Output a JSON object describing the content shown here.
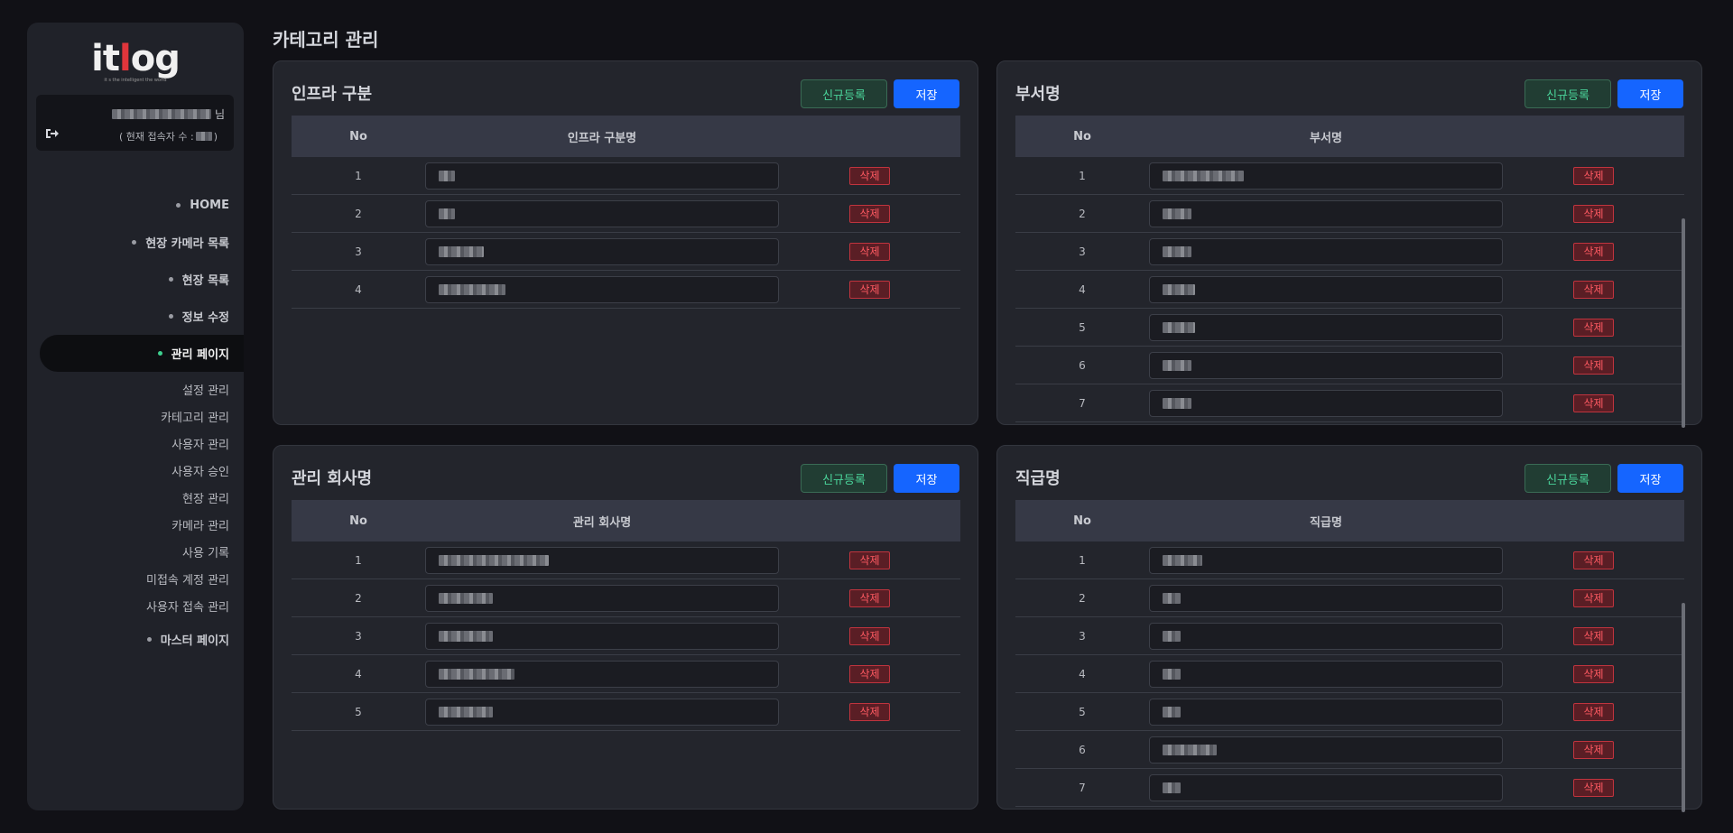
{
  "app": {
    "logo_main": "itlog",
    "logo_sub": "it s the intelligent the world"
  },
  "user": {
    "suffix": "님",
    "conn_prefix": "( 현재 접속자 수 :",
    "conn_suffix": ")"
  },
  "nav": {
    "items": [
      {
        "label": "HOME"
      },
      {
        "label": "현장 카메라 목록"
      },
      {
        "label": "현장 목록"
      },
      {
        "label": "정보 수정"
      },
      {
        "label": "관리 페이지"
      }
    ],
    "sub_items": [
      {
        "label": "설정 관리"
      },
      {
        "label": "카테고리 관리"
      },
      {
        "label": "사용자 관리"
      },
      {
        "label": "사용자 승인"
      },
      {
        "label": "현장 관리"
      },
      {
        "label": "카메라 관리"
      },
      {
        "label": "사용 기록"
      },
      {
        "label": "미접속 계정 관리"
      },
      {
        "label": "사용자 접속 관리"
      }
    ],
    "master": "마스터 페이지"
  },
  "page_title": "카테고리 관리",
  "buttons": {
    "new_label": "신규등록",
    "save_label": "저장",
    "delete_label": "삭제"
  },
  "panels": {
    "infra": {
      "title": "인프라 구분",
      "col_no": "No",
      "col_name": "인프라 구분명",
      "rows": [
        {
          "no": "1"
        },
        {
          "no": "2"
        },
        {
          "no": "3"
        },
        {
          "no": "4"
        }
      ]
    },
    "dept": {
      "title": "부서명",
      "col_no": "No",
      "col_name": "부서명",
      "rows": [
        {
          "no": "1"
        },
        {
          "no": "2"
        },
        {
          "no": "3"
        },
        {
          "no": "4"
        },
        {
          "no": "5"
        },
        {
          "no": "6"
        },
        {
          "no": "7"
        }
      ]
    },
    "company": {
      "title": "관리 회사명",
      "col_no": "No",
      "col_name": "관리 회사명",
      "rows": [
        {
          "no": "1"
        },
        {
          "no": "2"
        },
        {
          "no": "3"
        },
        {
          "no": "4"
        },
        {
          "no": "5"
        }
      ]
    },
    "rank": {
      "title": "직급명",
      "col_no": "No",
      "col_name": "직급명",
      "rows": [
        {
          "no": "1"
        },
        {
          "no": "2"
        },
        {
          "no": "3"
        },
        {
          "no": "4"
        },
        {
          "no": "5"
        },
        {
          "no": "6"
        },
        {
          "no": "7"
        }
      ]
    }
  },
  "colors": {
    "accent_blue": "#1565ff",
    "accent_green": "#3ecf8e",
    "danger": "#ff5a62"
  }
}
